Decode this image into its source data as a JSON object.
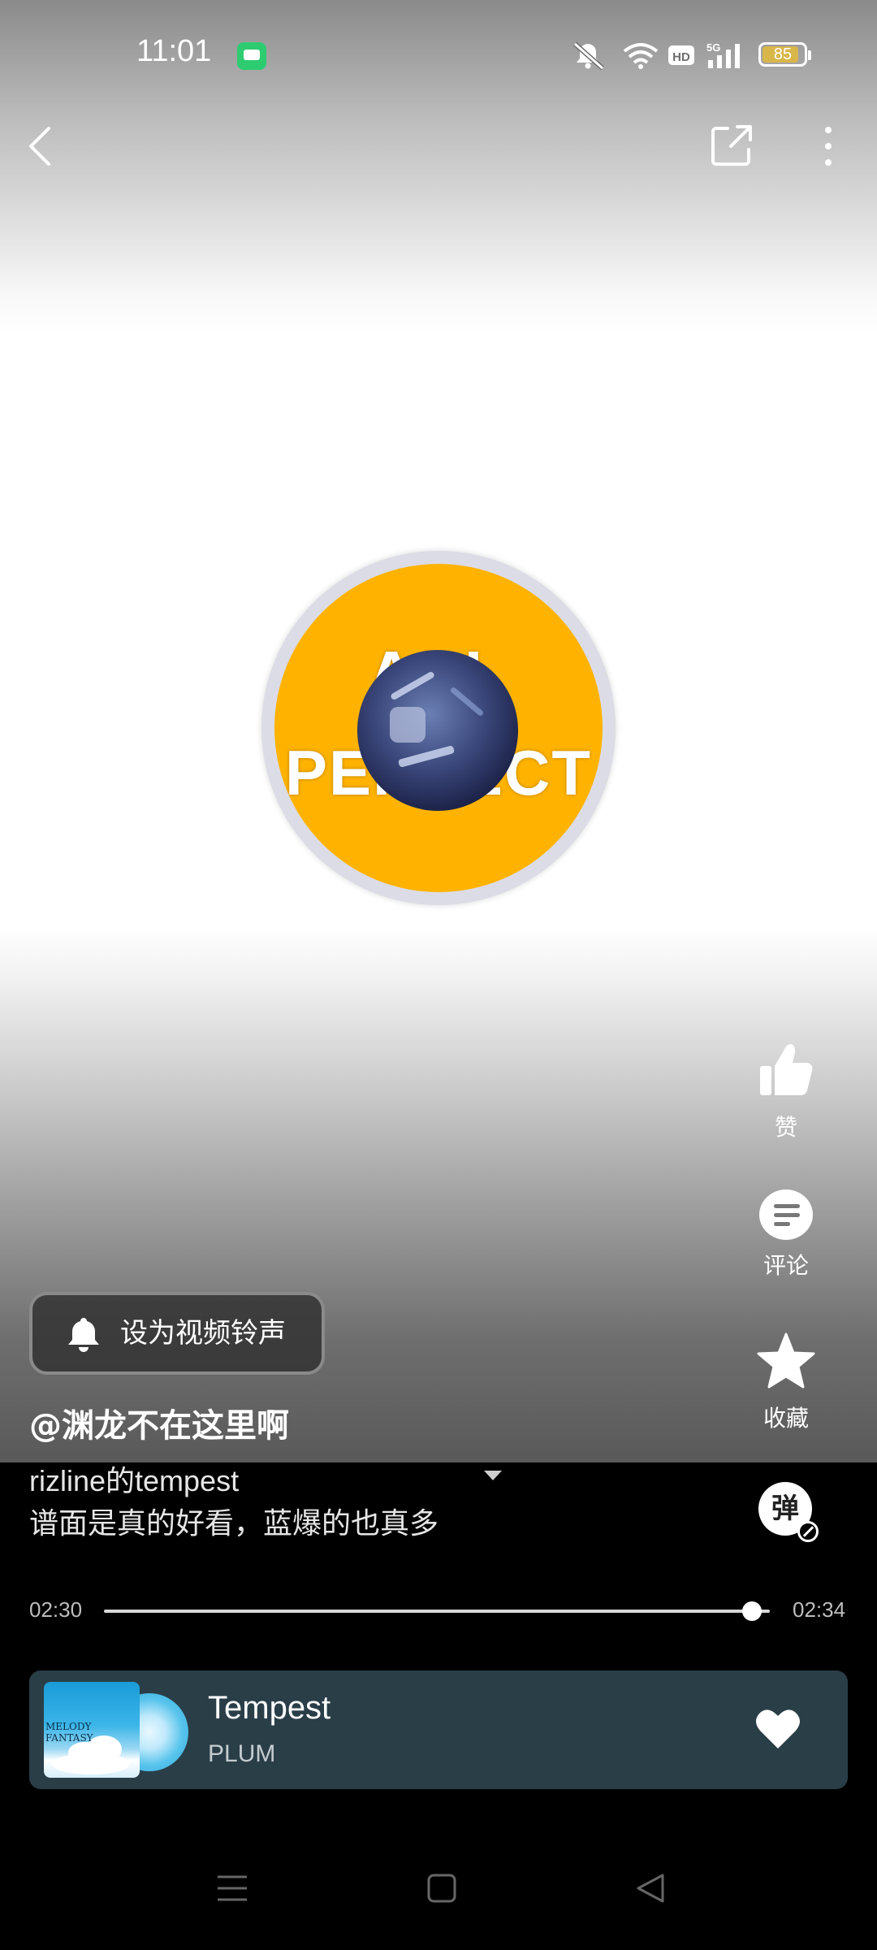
{
  "status_bar": {
    "time": "11:01",
    "battery": "85",
    "icons": [
      "message-app-icon",
      "mute-icon",
      "wifi-icon",
      "hd-icon",
      "5g-signal-icon",
      "battery-icon"
    ]
  },
  "top_bar": {
    "icons": [
      "back-icon",
      "share-icon",
      "more-icon"
    ]
  },
  "cover": {
    "text_line1": "ALL",
    "text_line2": "PERFECT"
  },
  "actions": {
    "like_label": "赞",
    "comment_label": "评论",
    "favorite_label": "收藏",
    "danmu_label": "弹"
  },
  "ringtone_button": {
    "label": "设为视频铃声"
  },
  "post": {
    "author": "@渊龙不在这里啊",
    "title": "rizline的tempest",
    "description": "谱面是真的好看，蓝爆的也真多"
  },
  "player": {
    "current_time": "02:30",
    "total_time": "02:34",
    "progress": 0.973
  },
  "music": {
    "song": "Tempest",
    "artist": "PLUM",
    "album_art_text": "MELODY FANTASY"
  },
  "colors": {
    "cover_yellow": "#ffb300",
    "card_bg": "#2a3e48",
    "battery_fill": "#d8b64a"
  }
}
